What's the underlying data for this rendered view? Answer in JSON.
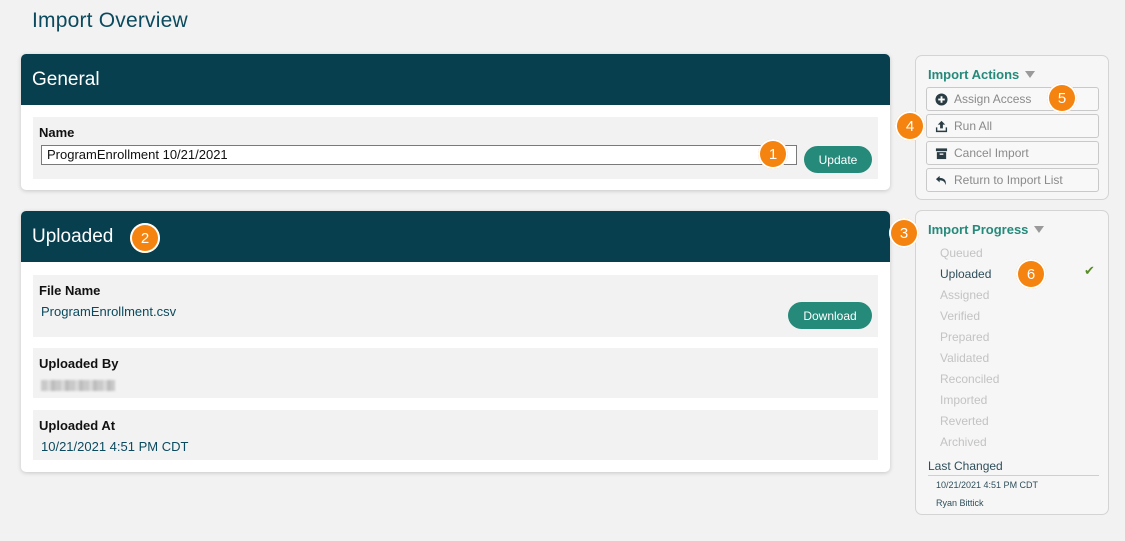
{
  "page": {
    "title": "Import Overview"
  },
  "general": {
    "header": "General",
    "name_label": "Name",
    "name_value": "ProgramEnrollment 10/21/2021",
    "update_label": "Update"
  },
  "uploaded": {
    "header": "Uploaded",
    "file_name_label": "File Name",
    "file_name_value": "ProgramEnrollment.csv",
    "download_label": "Download",
    "uploaded_by_label": "Uploaded By",
    "uploaded_at_label": "Uploaded At",
    "uploaded_at_value": "10/21/2021 4:51 PM CDT"
  },
  "import_actions": {
    "title": "Import Actions",
    "buttons": [
      {
        "label": "Assign Access",
        "icon": "plus-circle-icon"
      },
      {
        "label": "Run All",
        "icon": "upload-icon"
      },
      {
        "label": "Cancel Import",
        "icon": "archive-icon"
      },
      {
        "label": "Return to Import List",
        "icon": "undo-arrow-icon"
      }
    ]
  },
  "import_progress": {
    "title": "Import Progress",
    "steps": [
      "Queued",
      "Uploaded",
      "Assigned",
      "Verified",
      "Prepared",
      "Validated",
      "Reconciled",
      "Imported",
      "Reverted",
      "Archived"
    ],
    "active_step": "Uploaded",
    "check_mark": "✔",
    "last_changed_label": "Last Changed",
    "last_changed_date": "10/21/2021 4:51 PM CDT",
    "last_changed_user": "Ryan Bittick"
  },
  "badges": [
    "1",
    "2",
    "3",
    "4",
    "5",
    "6"
  ],
  "colors": {
    "header_bg": "#073f4f",
    "accent_green": "#258a7a",
    "badge_orange": "#f5830f"
  }
}
